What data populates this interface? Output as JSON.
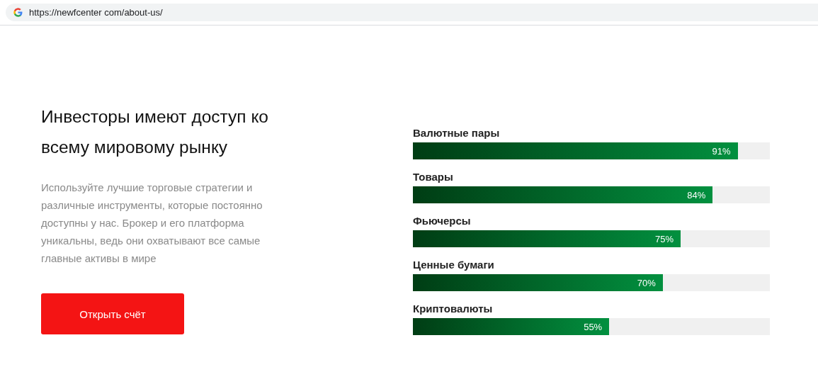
{
  "address_bar": {
    "url": "https://newfcenter com/about-us/"
  },
  "intro": {
    "heading": "Инвесторы имеют доступ ко всему мировому рынку",
    "text": "Используйте лучшие торговые стратегии и различные инструменты, которые постоянно доступны у нас. Брокер и его платформа уникальны, ведь они охватывают все самые главные активы в мире",
    "button": "Открыть счёт"
  },
  "skills": [
    {
      "name": "Валютные пары",
      "level": 0.91,
      "reading": "91%"
    },
    {
      "name": "Товары",
      "level": 0.84,
      "reading": "84%"
    },
    {
      "name": "Фьючерсы",
      "level": 0.75,
      "reading": "75%"
    },
    {
      "name": "Ценные бумаги",
      "level": 0.7,
      "reading": "70%"
    },
    {
      "name": "Криптовалюты",
      "level": 0.55,
      "reading": "55%"
    }
  ]
}
